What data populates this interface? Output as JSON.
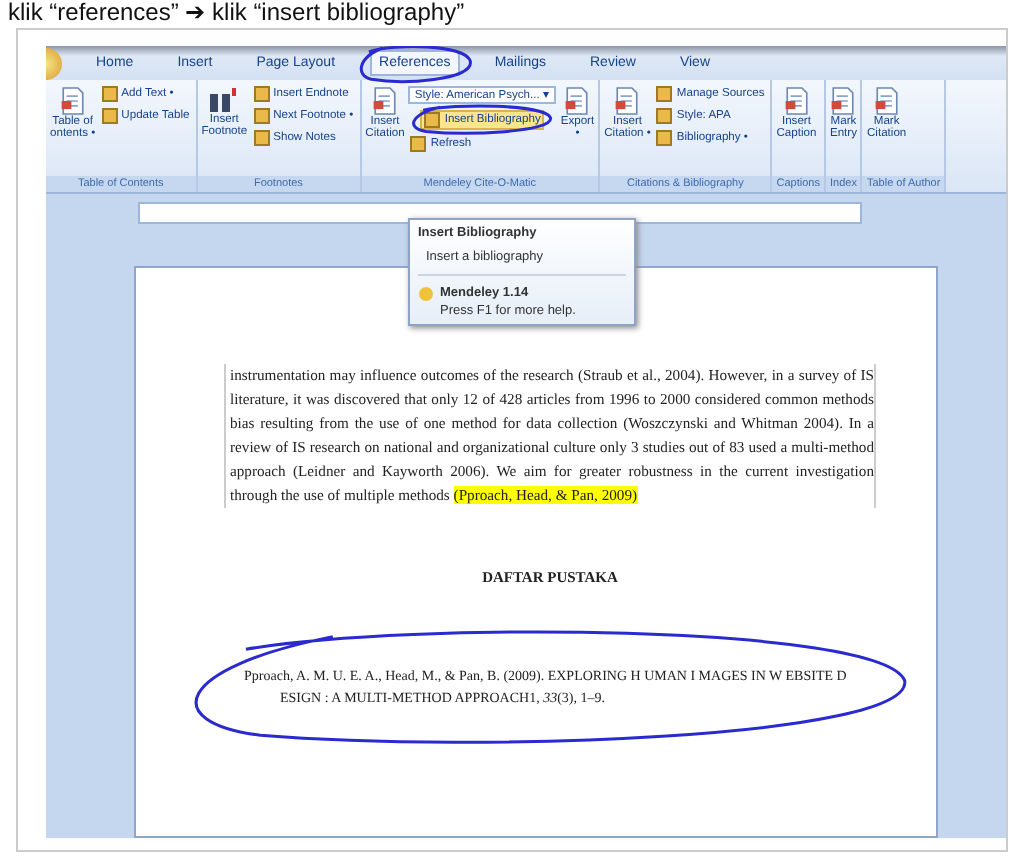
{
  "caption": "klik “references” ➔ klik “insert bibliography”",
  "tabs": [
    {
      "label": "Home",
      "selected": false
    },
    {
      "label": "Insert",
      "selected": false
    },
    {
      "label": "Page Layout",
      "selected": false
    },
    {
      "label": "References",
      "selected": true
    },
    {
      "label": "Mailings",
      "selected": false
    },
    {
      "label": "Review",
      "selected": false
    },
    {
      "label": "View",
      "selected": false
    }
  ],
  "ribbon": [
    {
      "label": "Table of Contents",
      "items": [
        {
          "kind": "large",
          "label": "Table of\nontents •"
        },
        {
          "kind": "stack",
          "items": [
            "Add Text •",
            "Update Table"
          ]
        }
      ]
    },
    {
      "label": "Footnotes",
      "items": [
        {
          "kind": "footnote",
          "label": "Insert\nFootnote"
        },
        {
          "kind": "stack",
          "items": [
            "Insert Endnote",
            "Next Footnote •",
            "Show Notes"
          ]
        }
      ]
    },
    {
      "label": "Mendeley Cite-O-Matic",
      "items": [
        {
          "kind": "large",
          "label": "Insert\nCitation"
        },
        {
          "kind": "mendeley",
          "style_label": "Style:",
          "style_value": "American Psych...",
          "caret": "▾",
          "items": [
            "Insert Bibliography",
            "Refresh"
          ]
        },
        {
          "kind": "large",
          "label": "Export\n•"
        }
      ]
    },
    {
      "label": "Citations & Bibliography",
      "items": [
        {
          "kind": "large",
          "label": "Insert\nCitation •"
        },
        {
          "kind": "stack",
          "items": [
            "Manage Sources",
            "Style: APA",
            "Bibliography •"
          ]
        }
      ]
    },
    {
      "label": "Captions",
      "items": [
        {
          "kind": "large",
          "label": "Insert\nCaption"
        }
      ]
    },
    {
      "label": "Index",
      "items": [
        {
          "kind": "large",
          "label": "Mark\nEntry"
        }
      ]
    },
    {
      "label": "Table of Author",
      "items": [
        {
          "kind": "large",
          "label": "Mark\nCitation"
        }
      ]
    }
  ],
  "tooltip": {
    "title": "Insert Bibliography",
    "description": "Insert a bibliography",
    "addin": "Mendeley 1.14",
    "help": "Press F1 for more help."
  },
  "document": {
    "paragraph": "instrumentation may influence outcomes of the research (Straub et al., 2004). However, in a survey of IS literature, it was discovered that only 12 of 428 articles from 1996 to 2000 considered common methods bias resulting from the use of one method for data collection (Woszczynski and Whitman 2004). In a review of IS research on national and organizational culture only 3 studies out of 83 used a multi-method approach (Leidner and Kayworth 2006). We aim for greater robustness in the current investigation through the use of multiple methods ",
    "highlight": "(Pproach, Head, & Pan, 2009)",
    "heading": "DAFTAR PUSTAKA",
    "reference": "Pproach, A. M. U. E. A., Head, M., & Pan, B. (2009). EXPLORING H UMAN I MAGES IN W EBSITE D ESIGN : A MULTI-METHOD APPROACH1, *33*(3), 1–9."
  }
}
